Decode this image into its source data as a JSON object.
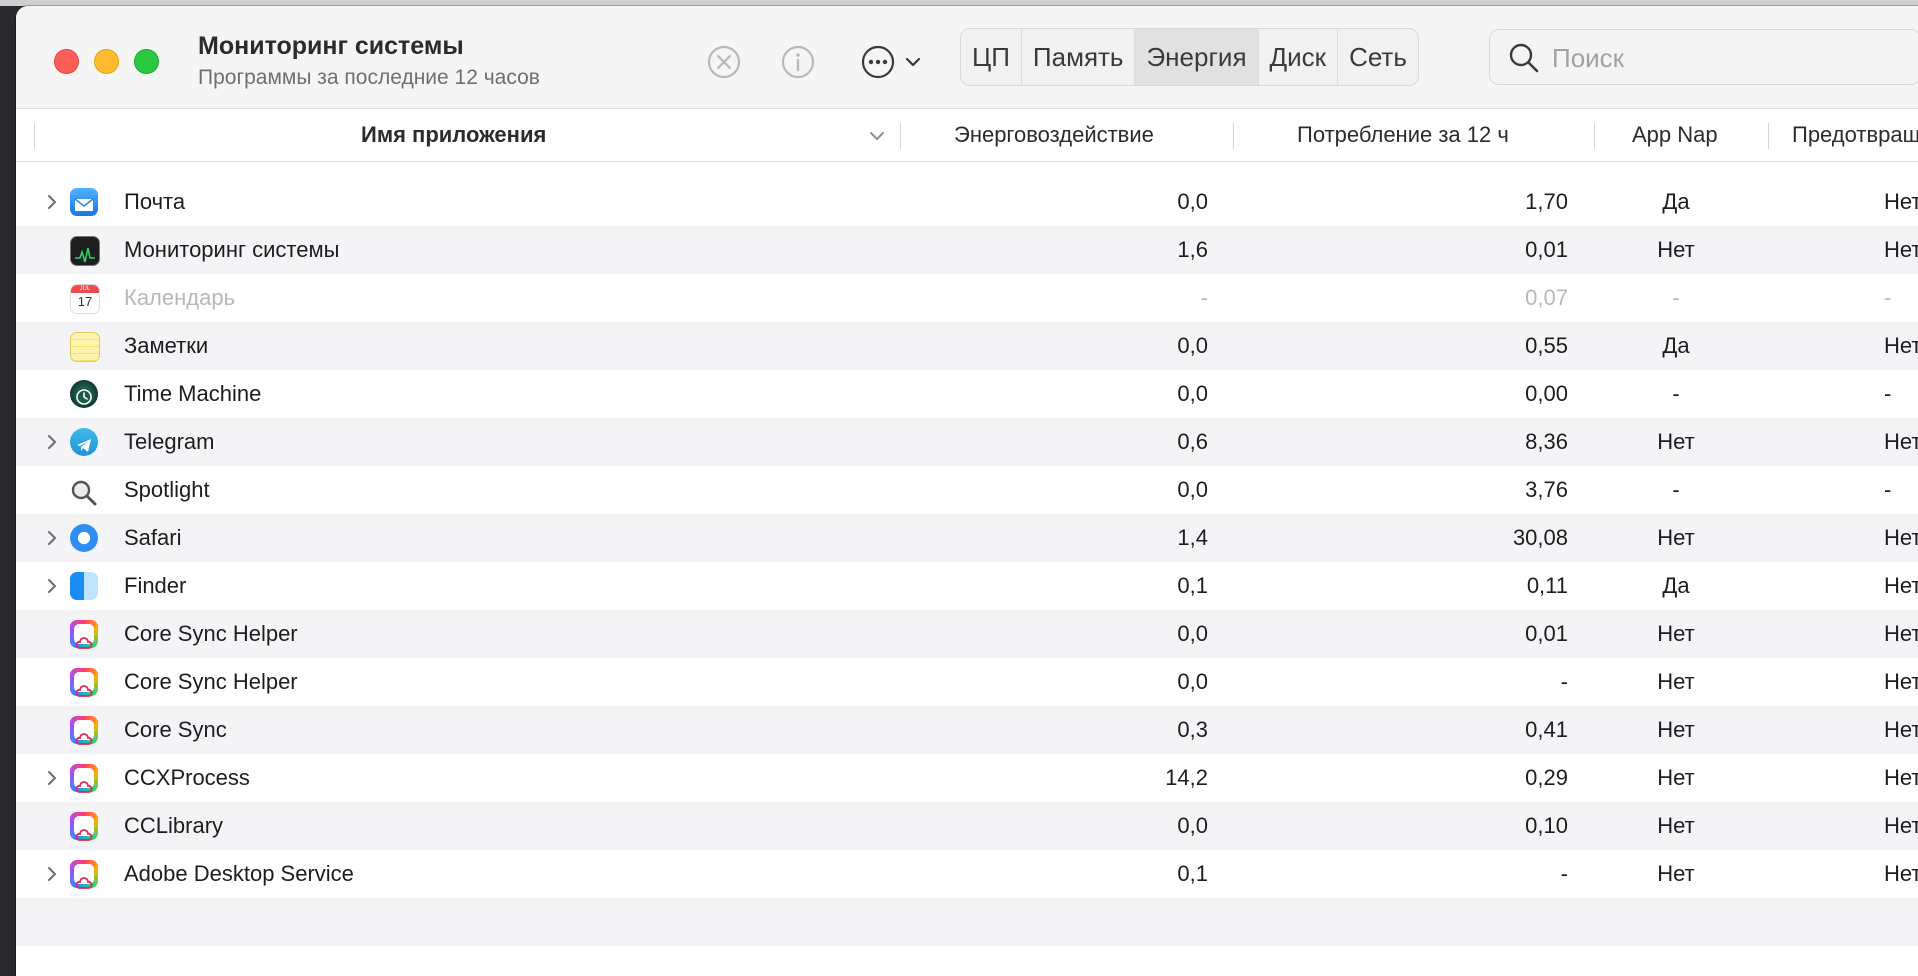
{
  "window": {
    "title": "Мониторинг системы",
    "subtitle": "Программы за последние 12 часов"
  },
  "toolbar": {
    "stop_icon": "stop-process-icon",
    "info_icon": "info-icon",
    "more_icon": "more-options-icon"
  },
  "tabs": [
    "ЦП",
    "Память",
    "Энергия",
    "Диск",
    "Сеть"
  ],
  "active_tab": "Энергия",
  "search": {
    "placeholder": "Поиск",
    "value": ""
  },
  "columns": {
    "name": "Имя приложения",
    "energy": "Энерговоздействие",
    "usage": "Потребление за 12 ч",
    "appnap": "App Nap",
    "prevent": "Предотвращ"
  },
  "rows": [
    {
      "name": "Почта",
      "energy": "0,0",
      "usage": "1,70",
      "appnap": "Да",
      "prevent": "Нет",
      "expandable": true,
      "icon": "mail-icon"
    },
    {
      "name": "Мониторинг системы",
      "energy": "1,6",
      "usage": "0,01",
      "appnap": "Нет",
      "prevent": "Нет",
      "expandable": false,
      "icon": "activity-monitor-icon"
    },
    {
      "name": "Календарь",
      "energy": "-",
      "usage": "0,07",
      "appnap": "-",
      "prevent": "-",
      "expandable": false,
      "icon": "calendar-icon",
      "dim": true,
      "calendar_month": "JUL",
      "calendar_day": "17"
    },
    {
      "name": "Заметки",
      "energy": "0,0",
      "usage": "0,55",
      "appnap": "Да",
      "prevent": "Нет",
      "expandable": false,
      "icon": "notes-icon"
    },
    {
      "name": "Time Machine",
      "energy": "0,0",
      "usage": "0,00",
      "appnap": "-",
      "prevent": "-",
      "expandable": false,
      "icon": "time-machine-icon"
    },
    {
      "name": "Telegram",
      "energy": "0,6",
      "usage": "8,36",
      "appnap": "Нет",
      "prevent": "Нет",
      "expandable": true,
      "icon": "telegram-icon"
    },
    {
      "name": "Spotlight",
      "energy": "0,0",
      "usage": "3,76",
      "appnap": "-",
      "prevent": "-",
      "expandable": false,
      "icon": "spotlight-icon"
    },
    {
      "name": "Safari",
      "energy": "1,4",
      "usage": "30,08",
      "appnap": "Нет",
      "prevent": "Нет",
      "expandable": true,
      "icon": "safari-icon"
    },
    {
      "name": "Finder",
      "energy": "0,1",
      "usage": "0,11",
      "appnap": "Да",
      "prevent": "Нет",
      "expandable": true,
      "icon": "finder-icon"
    },
    {
      "name": "Core Sync Helper",
      "energy": "0,0",
      "usage": "0,01",
      "appnap": "Нет",
      "prevent": "Нет",
      "expandable": false,
      "icon": "creative-cloud-icon"
    },
    {
      "name": "Core Sync Helper",
      "energy": "0,0",
      "usage": "-",
      "appnap": "Нет",
      "prevent": "Нет",
      "expandable": false,
      "icon": "creative-cloud-icon"
    },
    {
      "name": "Core Sync",
      "energy": "0,3",
      "usage": "0,41",
      "appnap": "Нет",
      "prevent": "Нет",
      "expandable": false,
      "icon": "creative-cloud-icon"
    },
    {
      "name": "CCXProcess",
      "energy": "14,2",
      "usage": "0,29",
      "appnap": "Нет",
      "prevent": "Нет",
      "expandable": true,
      "icon": "creative-cloud-icon"
    },
    {
      "name": "CCLibrary",
      "energy": "0,0",
      "usage": "0,10",
      "appnap": "Нет",
      "prevent": "Нет",
      "expandable": false,
      "icon": "creative-cloud-icon"
    },
    {
      "name": "Adobe Desktop Service",
      "energy": "0,1",
      "usage": "-",
      "appnap": "Нет",
      "prevent": "Нет",
      "expandable": true,
      "icon": "creative-cloud-icon"
    }
  ]
}
